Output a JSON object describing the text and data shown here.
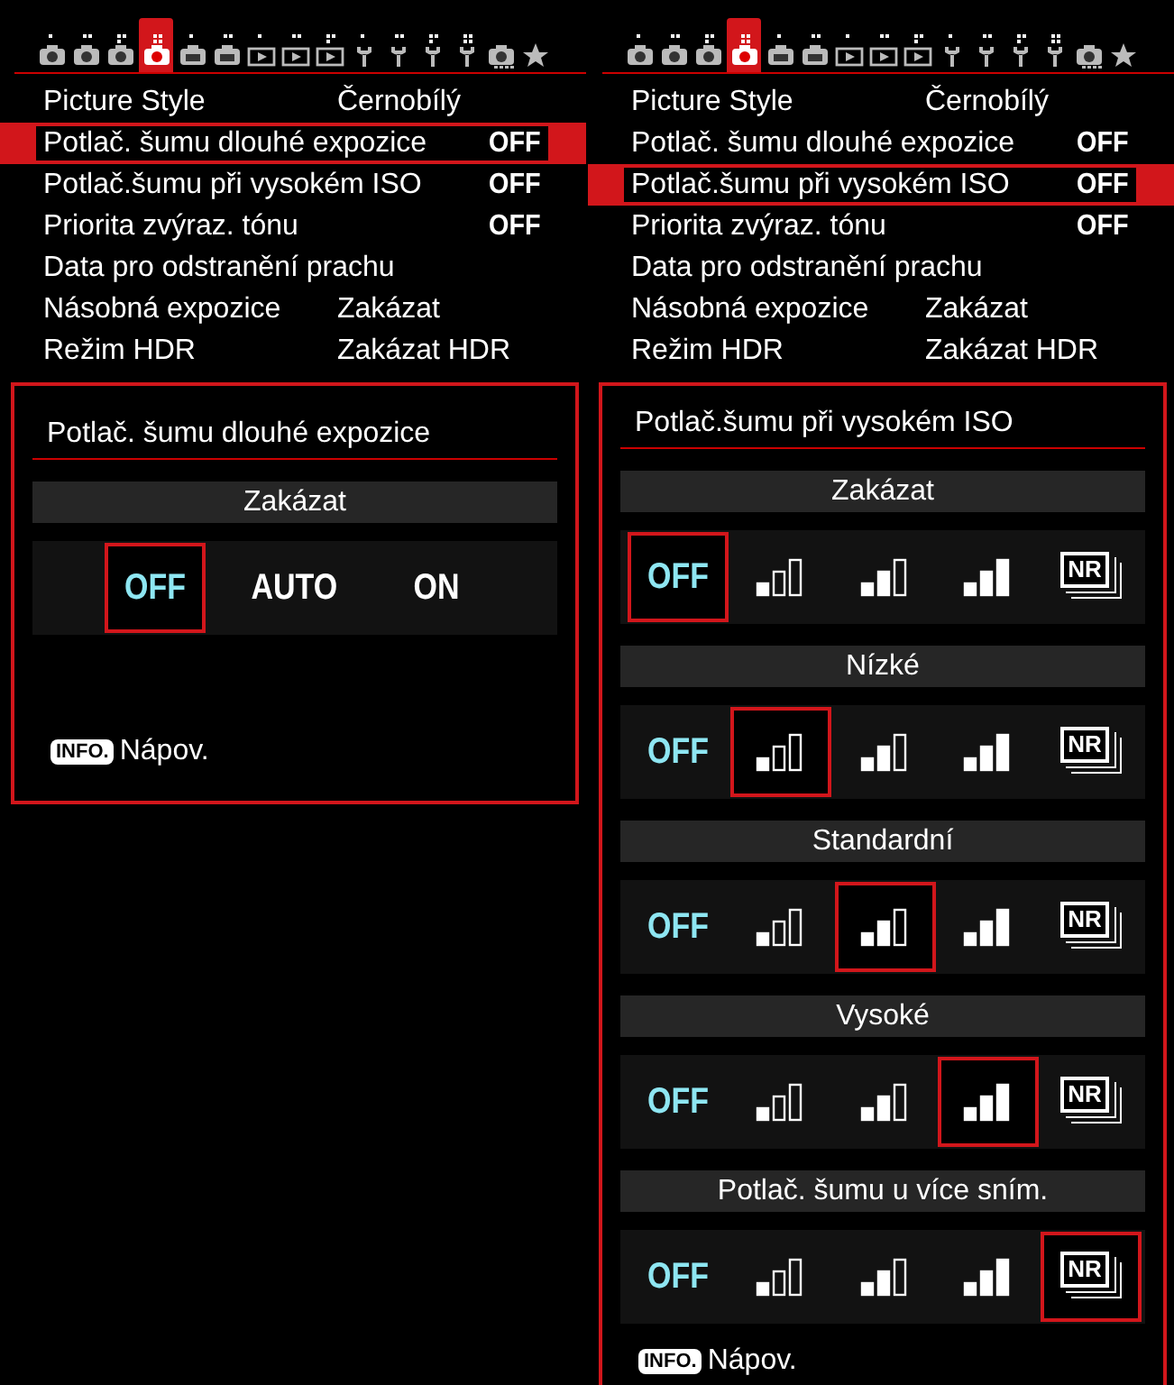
{
  "screens": [
    {
      "tabs": [
        {
          "kind": "shoot",
          "selected": false
        },
        {
          "kind": "shoot",
          "selected": false
        },
        {
          "kind": "shoot",
          "selected": false
        },
        {
          "kind": "shoot",
          "selected": true
        },
        {
          "kind": "live",
          "selected": false
        },
        {
          "kind": "live",
          "selected": false
        },
        {
          "kind": "play",
          "selected": false
        },
        {
          "kind": "play",
          "selected": false
        },
        {
          "kind": "play",
          "selected": false
        },
        {
          "kind": "setup",
          "selected": false
        },
        {
          "kind": "setup",
          "selected": false
        },
        {
          "kind": "setup",
          "selected": false
        },
        {
          "kind": "setup",
          "selected": false
        },
        {
          "kind": "custom",
          "selected": false
        },
        {
          "kind": "star",
          "selected": false
        }
      ],
      "menu": [
        {
          "label": "Picture Style",
          "value": "Černobílý",
          "kind": "choice",
          "selected": false
        },
        {
          "label": "Potlač. šumu dlouhé expozice",
          "value": "OFF",
          "kind": "switch",
          "selected": true
        },
        {
          "label": "Potlač.šumu při vysokém ISO",
          "value": "OFF",
          "kind": "switch",
          "selected": false
        },
        {
          "label": "Priorita zvýraz. tónu",
          "value": "OFF",
          "kind": "switch",
          "selected": false
        },
        {
          "label": "Data pro odstranění prachu",
          "selected": false
        },
        {
          "label": "Násobná expozice",
          "value": "Zakázat",
          "kind": "choice",
          "selected": false
        },
        {
          "label": "Režim HDR",
          "value": "Zakázat HDR",
          "kind": "choice",
          "selected": false
        }
      ],
      "panel": {
        "title": "Potlač. šumu dlouhé expozice",
        "groups": [
          {
            "heading": "Zakázat",
            "options": [
              {
                "kind": "text",
                "label": "OFF",
                "current": true,
                "selected": true
              },
              {
                "kind": "text",
                "label": "AUTO",
                "current": false,
                "selected": false
              },
              {
                "kind": "text",
                "label": "ON",
                "current": false,
                "selected": false
              }
            ]
          }
        ],
        "footer": {
          "key": "INFO.",
          "text": "Nápov."
        }
      }
    },
    {
      "tabs": [
        {
          "kind": "shoot",
          "selected": false
        },
        {
          "kind": "shoot",
          "selected": false
        },
        {
          "kind": "shoot",
          "selected": false
        },
        {
          "kind": "shoot",
          "selected": true
        },
        {
          "kind": "live",
          "selected": false
        },
        {
          "kind": "live",
          "selected": false
        },
        {
          "kind": "play",
          "selected": false
        },
        {
          "kind": "play",
          "selected": false
        },
        {
          "kind": "play",
          "selected": false
        },
        {
          "kind": "setup",
          "selected": false
        },
        {
          "kind": "setup",
          "selected": false
        },
        {
          "kind": "setup",
          "selected": false
        },
        {
          "kind": "setup",
          "selected": false
        },
        {
          "kind": "custom",
          "selected": false
        },
        {
          "kind": "star",
          "selected": false
        }
      ],
      "menu": [
        {
          "label": "Picture Style",
          "value": "Černobílý",
          "kind": "choice",
          "selected": false
        },
        {
          "label": "Potlač. šumu dlouhé expozice",
          "value": "OFF",
          "kind": "switch",
          "selected": false
        },
        {
          "label": "Potlač.šumu při vysokém ISO",
          "value": "OFF",
          "kind": "switch",
          "selected": true
        },
        {
          "label": "Priorita zvýraz. tónu",
          "value": "OFF",
          "kind": "switch",
          "selected": false
        },
        {
          "label": "Data pro odstranění prachu",
          "selected": false
        },
        {
          "label": "Násobná expozice",
          "value": "Zakázat",
          "kind": "choice",
          "selected": false
        },
        {
          "label": "Režim HDR",
          "value": "Zakázat HDR",
          "kind": "choice",
          "selected": false
        }
      ],
      "panel": {
        "title": "Potlač.šumu při vysokém ISO",
        "groups": [
          {
            "heading": "Zakázat",
            "options": [
              {
                "kind": "text",
                "label": "OFF",
                "current": true,
                "selected": true
              },
              {
                "kind": "low",
                "selected": false
              },
              {
                "kind": "standard",
                "selected": false
              },
              {
                "kind": "high",
                "selected": false
              },
              {
                "kind": "multi",
                "label": "NR",
                "selected": false
              }
            ]
          },
          {
            "heading": "Nízké",
            "options": [
              {
                "kind": "text",
                "label": "OFF",
                "current": true,
                "selected": false
              },
              {
                "kind": "low",
                "selected": true
              },
              {
                "kind": "standard",
                "selected": false
              },
              {
                "kind": "high",
                "selected": false
              },
              {
                "kind": "multi",
                "label": "NR",
                "selected": false
              }
            ]
          },
          {
            "heading": "Standardní",
            "options": [
              {
                "kind": "text",
                "label": "OFF",
                "current": true,
                "selected": false
              },
              {
                "kind": "low",
                "selected": false
              },
              {
                "kind": "standard",
                "selected": true
              },
              {
                "kind": "high",
                "selected": false
              },
              {
                "kind": "multi",
                "label": "NR",
                "selected": false
              }
            ]
          },
          {
            "heading": "Vysoké",
            "options": [
              {
                "kind": "text",
                "label": "OFF",
                "current": true,
                "selected": false
              },
              {
                "kind": "low",
                "selected": false
              },
              {
                "kind": "standard",
                "selected": false
              },
              {
                "kind": "high",
                "selected": true
              },
              {
                "kind": "multi",
                "label": "NR",
                "selected": false
              }
            ]
          },
          {
            "heading": "Potlač. šumu u více sním.",
            "options": [
              {
                "kind": "text",
                "label": "OFF",
                "current": true,
                "selected": false
              },
              {
                "kind": "low",
                "selected": false
              },
              {
                "kind": "standard",
                "selected": false
              },
              {
                "kind": "high",
                "selected": false
              },
              {
                "kind": "multi",
                "label": "NR",
                "selected": true
              }
            ]
          }
        ],
        "footer": {
          "key": "INFO.",
          "text": "Nápov."
        }
      }
    }
  ]
}
